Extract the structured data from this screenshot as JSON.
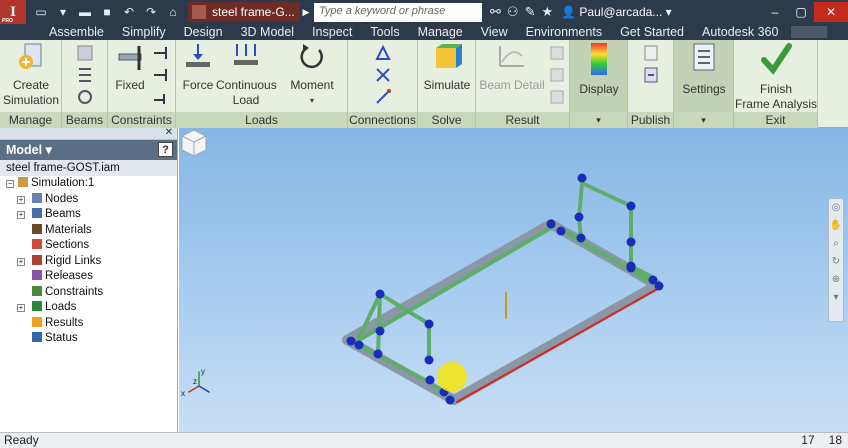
{
  "titlebar": {
    "app_logo": "I",
    "app_logo_sub": "PRO",
    "doc_tab": "steel frame-G...",
    "search_placeholder": "Type a keyword or phrase",
    "user": "Paul@arcada..."
  },
  "ribbon_tabs": [
    "Assemble",
    "Simplify",
    "Design",
    "3D Model",
    "Inspect",
    "Tools",
    "Manage",
    "View",
    "Environments",
    "Get Started",
    "Autodesk 360"
  ],
  "ribbon": {
    "create_simulation": "Create\nSimulation",
    "fixed": "Fixed",
    "force": "Force",
    "continuous_load": "Continuous\nLoad",
    "moment": "Moment",
    "simulate": "Simulate",
    "beam_detail": "Beam Detail",
    "display": "Display",
    "settings": "Settings",
    "finish": "Finish\nFrame Analysis",
    "groups": {
      "manage": "Manage",
      "beams": "Beams",
      "constraints": "Constraints",
      "loads": "Loads",
      "connections": "Connections",
      "solve": "Solve",
      "result": "Result",
      "publish": "Publish",
      "exit": "Exit"
    }
  },
  "model_panel": {
    "title": "Model",
    "help": "?",
    "root": "steel frame-GOST.iam",
    "simulation": "Simulation:1",
    "items": [
      "Nodes",
      "Beams",
      "Materials",
      "Sections",
      "Rigid Links",
      "Releases",
      "Constraints",
      "Loads",
      "Results",
      "Status"
    ]
  },
  "axis": {
    "x": "x",
    "y": "y",
    "z": "z"
  },
  "status": {
    "text": "Ready",
    "num1": "17",
    "num2": "18"
  },
  "colors": {
    "beam": "#5cae6a",
    "beam_shadow": "#8a97a6",
    "node": "#1a2bbd",
    "selected_beam": "#d9251d",
    "viewport_top": "#87b6e5"
  }
}
